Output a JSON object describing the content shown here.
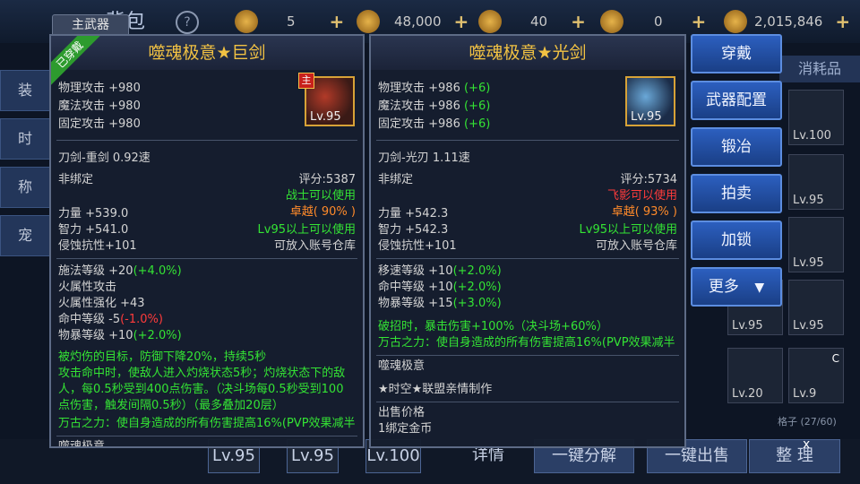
{
  "header": {
    "title": "背包",
    "help": "?",
    "currencies": [
      {
        "value": "5",
        "plus": "+"
      },
      {
        "value": "48,000",
        "plus": "+"
      },
      {
        "value": "40",
        "plus": "+"
      },
      {
        "value": "0",
        "plus": "+"
      },
      {
        "value": "2,015,846",
        "plus": "+"
      }
    ]
  },
  "left_tabs": [
    "装",
    "时",
    "称",
    "宠"
  ],
  "inventory": {
    "tab": "消耗品",
    "slots": [
      "Lv.100",
      "Lv.95",
      "Lv.95",
      "Lv.95",
      "Lv.95",
      "Lv.95",
      "Lv.20",
      "Lv.9"
    ],
    "capacity": "格子 (27/60)",
    "slot_c": "C"
  },
  "bottom": {
    "slots": [
      "Lv.95",
      "Lv.95",
      "Lv.100"
    ],
    "details": "详情",
    "decompose": "一键分解",
    "sell": "一键出售",
    "sort": "整 理",
    "close": "x"
  },
  "left_panel": {
    "tab": "主武器",
    "ribbon": "已穿戴",
    "name": "噬魂极意★巨剑",
    "main_tag": "主",
    "level": "Lv.95",
    "stats": [
      "物理攻击 +980",
      "魔法攻击 +980",
      "固定攻击 +980"
    ],
    "type": "刀剑-重剑   0.92速",
    "bind": "非绑定",
    "score": "评分:5387",
    "class_req": "战士可以使用",
    "quality": "卓越( 90% )",
    "attrs": [
      "力量 +539.0",
      "智力 +541.0",
      "侵蚀抗性+101"
    ],
    "req_level": "Lv95以上可以使用",
    "storage": "可放入账号仓库",
    "bonus": [
      {
        "text": "施法等级 +20",
        "extra": "(+4.0%)",
        "color": "green"
      },
      {
        "text": "火属性攻击",
        "extra": "",
        "color": ""
      },
      {
        "text": "火属性强化 +43",
        "extra": "",
        "color": ""
      },
      {
        "text": "命中等级 -5",
        "extra": "(-1.0%)",
        "color": "red"
      },
      {
        "text": "物暴等级 +10",
        "extra": "(+2.0%)",
        "color": "green"
      }
    ],
    "effects": [
      "被灼伤的目标，防御下降20%，持续5秒",
      "攻击命中时，使敌人进入灼烧状态5秒；灼烧状态下的敌",
      "人，每0.5秒受到400点伤害。（决斗场每0.5秒受到100",
      "点伤害，触发间隔0.5秒）（最多叠加20层）",
      "万古之力：使自身造成的所有伤害提高16%(PVP效果减半"
    ],
    "footer": "噬魂极意"
  },
  "right_panel": {
    "name": "噬魂极意★光剑",
    "level": "Lv.95",
    "stats": [
      {
        "text": "物理攻击 +986",
        "extra": "(+6)"
      },
      {
        "text": "魔法攻击 +986",
        "extra": "(+6)"
      },
      {
        "text": "固定攻击 +986",
        "extra": "(+6)"
      }
    ],
    "type": "刀剑-光刃   1.11速",
    "bind": "非绑定",
    "score": "评分:5734",
    "class_req": "飞影可以使用",
    "quality": "卓越( 93% )",
    "attrs": [
      "力量 +542.3",
      "智力 +542.3",
      "侵蚀抗性+101"
    ],
    "req_level": "Lv95以上可以使用",
    "storage": "可放入账号仓库",
    "bonus": [
      {
        "text": "移速等级 +10",
        "extra": "(+2.0%)"
      },
      {
        "text": "命中等级 +10",
        "extra": "(+2.0%)"
      },
      {
        "text": "物暴等级 +15",
        "extra": "(+3.0%)"
      }
    ],
    "effects": [
      "破招时，暴击伤害+100%（决斗场+60%）",
      "万古之力：使自身造成的所有伤害提高16%(PVP效果减半"
    ],
    "set_name": "噬魂极意",
    "maker": "★时空★联盟亲情制作",
    "price_label": "出售价格",
    "price": "1绑定金币"
  },
  "menu": {
    "wear": "穿戴",
    "config": "武器配置",
    "forge": "锻冶",
    "auction": "拍卖",
    "lock": "加锁",
    "more": "更多",
    "more_arrow": "▼"
  }
}
